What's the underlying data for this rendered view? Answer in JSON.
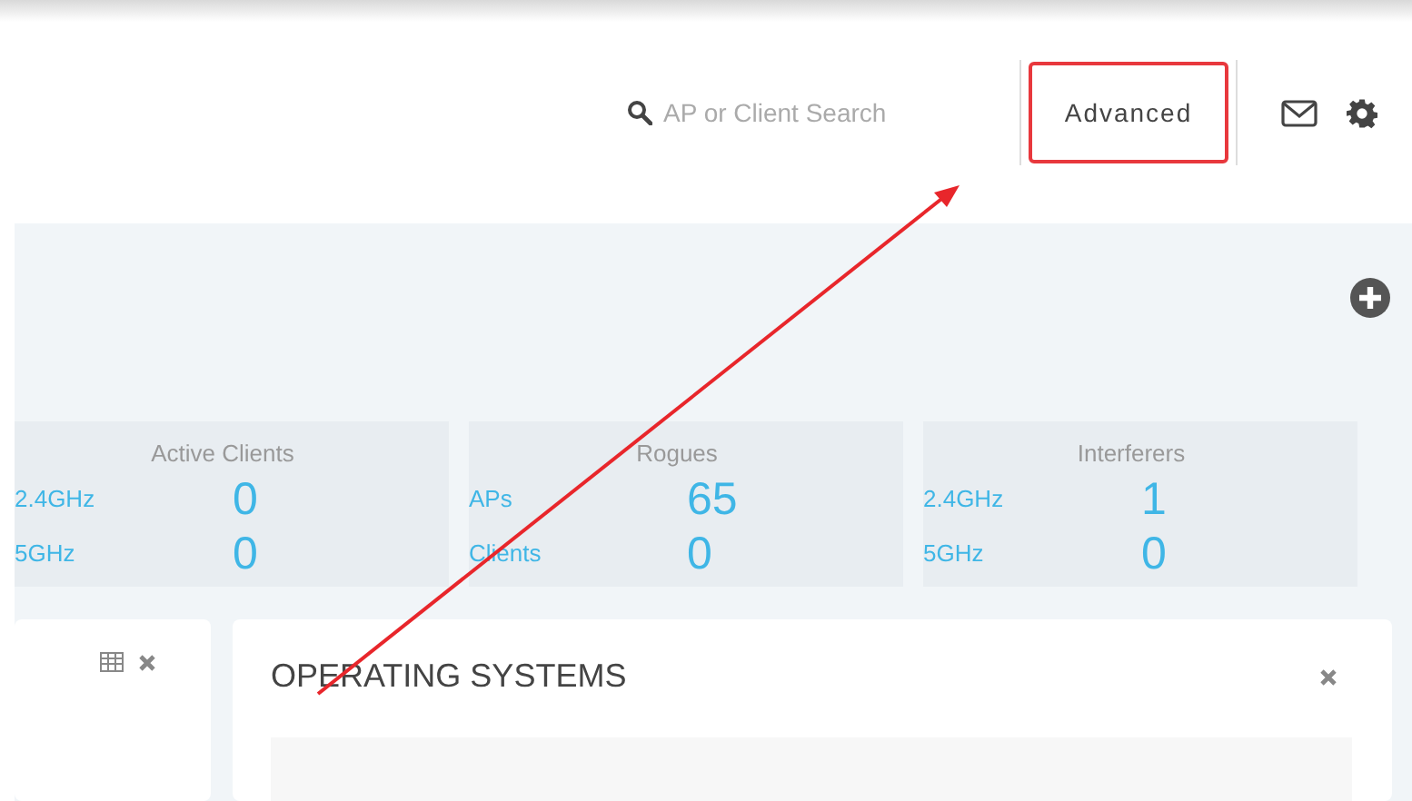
{
  "header": {
    "search": {
      "placeholder": "AP or Client Search"
    },
    "advanced_button": {
      "label": "Advanced",
      "highlighted": true
    }
  },
  "stat_cards": [
    {
      "title": "Active Clients",
      "rows": [
        {
          "label": "2.4GHz",
          "value": "0"
        },
        {
          "label": "5GHz",
          "value": "0"
        }
      ]
    },
    {
      "title": "Rogues",
      "rows": [
        {
          "label": "APs",
          "value": "65"
        },
        {
          "label": "Clients",
          "value": "0"
        }
      ]
    },
    {
      "title": "Interferers",
      "rows": [
        {
          "label": "2.4GHz",
          "value": "1"
        },
        {
          "label": "5GHz",
          "value": "0"
        }
      ]
    }
  ],
  "panels": [
    {
      "table_toggle": true
    },
    {
      "title": "OPERATING SYSTEMS",
      "table_toggle": false
    }
  ]
}
